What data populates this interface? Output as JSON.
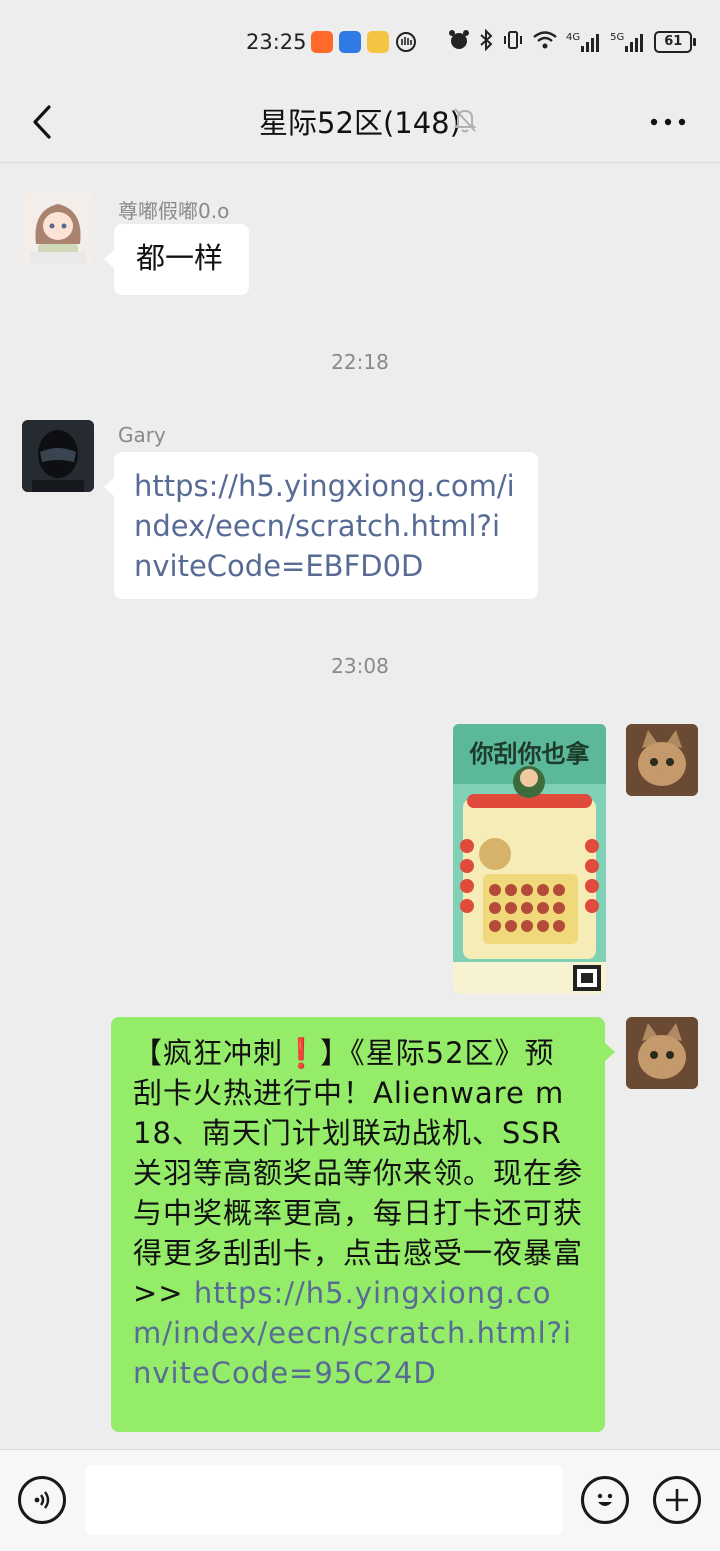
{
  "status": {
    "time": "23:25",
    "net_a": "4G",
    "net_b": "5G",
    "battery": "61"
  },
  "header": {
    "title": "星际52区(148)"
  },
  "messages": {
    "m1": {
      "sender": "尊嘟假嘟0.o",
      "text": "都一样"
    },
    "t1": "22:18",
    "m2": {
      "sender": "Gary",
      "link": "https://h5.yingxiong.com/index/eecn/scratch.html?inviteCode=EBFD0D"
    },
    "t2": "23:08",
    "m3": {
      "type": "image",
      "poster_title": "你刮你也拿"
    },
    "m4": {
      "text_a": "【疯狂冲刺",
      "emoji": "❗",
      "text_b": "】《星际52区》预刮卡火热进行中！Alienware m18、南天门计划联动战机、SSR关羽等高额奖品等你来领。现在参与中奖概率更高，每日打卡还可获得更多刮刮卡，点击感受一夜暴富>> ",
      "link": "https://h5.yingxiong.com/index/eecn/scratch.html?inviteCode=95C24D"
    }
  },
  "colors": {
    "bubble_self": "#95ec69",
    "link": "#576b95",
    "background": "#ededed"
  },
  "icons": {
    "back": "chevron-left-icon",
    "mute": "bell-off-icon",
    "more": "more-dots-icon",
    "voice": "voice-icon",
    "emoji": "emoji-icon",
    "add": "plus-icon"
  }
}
